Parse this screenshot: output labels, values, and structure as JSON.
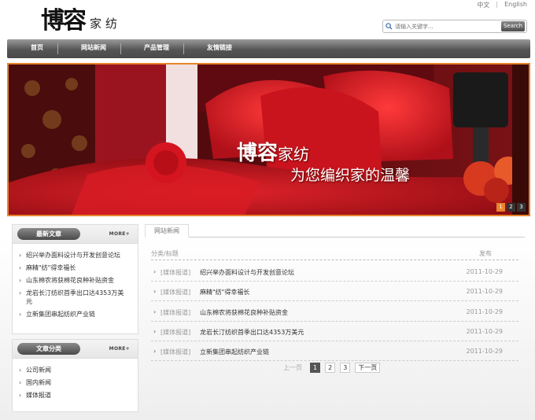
{
  "brand": {
    "logo_big": "博容",
    "logo_small": "家纺"
  },
  "lang": {
    "zh": "中文",
    "sep": "|",
    "en": "English"
  },
  "search": {
    "placeholder": "请输入关键字...",
    "button": "Search"
  },
  "nav": {
    "items": [
      "首页",
      "网站新闻",
      "产品管理",
      "友情链接"
    ]
  },
  "banner": {
    "title_bold": "博容",
    "title_rest": "家纺",
    "subtitle": "为您编织家的温馨",
    "slides": [
      "1",
      "2",
      "3"
    ],
    "active_slide": "1"
  },
  "latest": {
    "title": "最新文章",
    "more": "MORE+",
    "items": [
      "绍兴举办面料设计与开发创意论坛",
      "麻精\"纺\"得幸福长",
      "山东棉农将获棉花良种补贴资金",
      "龙岩长汀纺织首季出口达4353万美元",
      "立新集团串起纺织产业链"
    ]
  },
  "categories": {
    "title": "文章分类",
    "more": "MORE+",
    "items": [
      "公司新闻",
      "国内新闻",
      "媒体报道"
    ]
  },
  "main": {
    "tab": "网站新闻",
    "col_title": "分类/标题",
    "col_date": "发布",
    "rows": [
      {
        "cat": "[媒体报道]",
        "title": "绍兴举办面料设计与开发创意论坛",
        "date": "2011-10-29"
      },
      {
        "cat": "[媒体报道]",
        "title": "麻精\"纺\"得幸福长",
        "date": "2011-10-29"
      },
      {
        "cat": "[媒体报道]",
        "title": "山东棉农将获棉花良种补贴资金",
        "date": "2011-10-29"
      },
      {
        "cat": "[媒体报道]",
        "title": "龙岩长汀纺织首季出口达4353万美元",
        "date": "2011-10-29"
      },
      {
        "cat": "[媒体报道]",
        "title": "立新集团串起纺织产业链",
        "date": "2011-10-29"
      }
    ]
  },
  "pager": {
    "prev": "上一页",
    "pages": [
      "1",
      "2",
      "3"
    ],
    "current": "1",
    "next": "下一页"
  }
}
